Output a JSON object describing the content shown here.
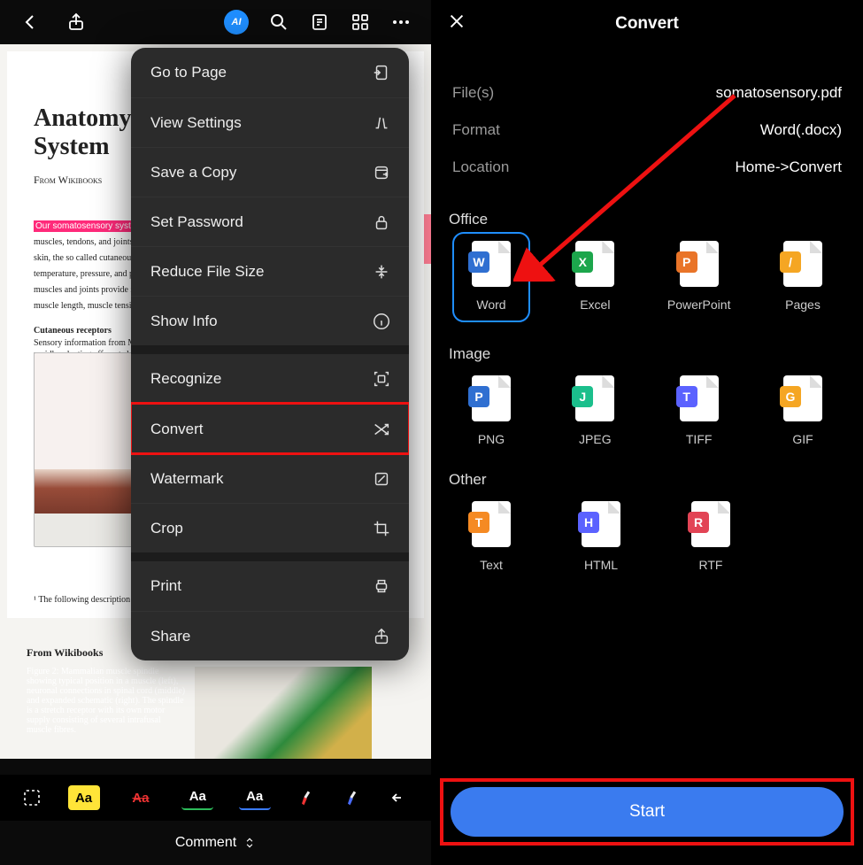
{
  "left": {
    "ai_badge": "AI",
    "document": {
      "title": "Anatomy of the Somatosensory System",
      "subtitle": "From Wikibooks",
      "highlight": "Our somatosensory system",
      "para1": "and sensors in our muscles, tendons, and joints. The receptors in the skin, the so called cutaneous receptors, tell us about temperature, pressure, and pain. The receptors in muscles and joints provide information about muscle length, muscle tension, and joint angles.",
      "para2head": "Cutaneous receptors",
      "para2": "Sensory information from Meissner corpuscles and rapidly adapting afferents leads to adjustment of grip force when objects are lifted. These afferents respond with a brief burst of action potentials when objects move a small distance during the early stages of lifting.",
      "footnote": "¹ The following description is based on lecture notes.",
      "fig2sub": "From Wikibooks",
      "fig2cap": "Figure 2: Mammalian muscle spindle showing typical position in a muscle (left), neuronal connections in spinal cord (middle) and expanded schematic (right). The spindle is a stretch receptor with its own motor supply consisting of several intrafusal muscle fibres."
    },
    "menu": {
      "goto": "Go to Page",
      "view": "View Settings",
      "save": "Save a Copy",
      "password": "Set Password",
      "reduce": "Reduce File Size",
      "info": "Show Info",
      "recognize": "Recognize",
      "convert": "Convert",
      "watermark": "Watermark",
      "crop": "Crop",
      "print": "Print",
      "share": "Share"
    },
    "toolbar": {
      "aa": "Aa"
    },
    "comment": "Comment"
  },
  "right": {
    "title": "Convert",
    "meta": {
      "files_k": "File(s)",
      "files_v": "somatosensory.pdf",
      "format_k": "Format",
      "format_v": "Word(.docx)",
      "location_k": "Location",
      "location_v": "Home->Convert"
    },
    "sections": {
      "office": "Office",
      "image": "Image",
      "other": "Other"
    },
    "formats": {
      "word": "Word",
      "excel": "Excel",
      "ppt": "PowerPoint",
      "pages": "Pages",
      "png": "PNG",
      "jpeg": "JPEG",
      "tiff": "TIFF",
      "gif": "GIF",
      "text": "Text",
      "html": "HTML",
      "rtf": "RTF"
    },
    "start": "Start"
  }
}
